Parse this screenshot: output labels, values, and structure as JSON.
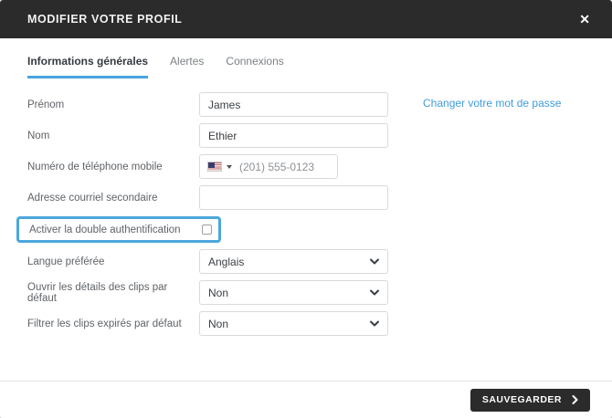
{
  "modal": {
    "title": "MODIFIER VOTRE PROFIL",
    "close_icon": "✕"
  },
  "tabs": [
    {
      "label": "Informations générales",
      "active": true
    },
    {
      "label": "Alertes",
      "active": false
    },
    {
      "label": "Connexions",
      "active": false
    }
  ],
  "form": {
    "first_name": {
      "label": "Prénom",
      "value": "James"
    },
    "last_name": {
      "label": "Nom",
      "value": "Ethier"
    },
    "phone": {
      "label": "Numéro de téléphone mobile",
      "placeholder": "(201) 555-0123",
      "flag": "us-flag",
      "country_caret": "caret-down"
    },
    "secondary_email": {
      "label": "Adresse courriel secondaire",
      "value": "",
      "placeholder": ""
    },
    "two_factor": {
      "label": "Activer la double authentification",
      "checked": false
    },
    "language": {
      "label": "Langue préférée",
      "value": "Anglais"
    },
    "open_clip_details": {
      "label": "Ouvrir les détails des clips par défaut",
      "value": "Non"
    },
    "filter_expired_clips": {
      "label": "Filtrer les clips expirés par défaut",
      "value": "Non"
    }
  },
  "links": {
    "change_password": "Changer votre mot de passe"
  },
  "footer": {
    "save_label": "SAUVEGARDER"
  },
  "colors": {
    "header_dark": "#2b2b2b",
    "accent_blue": "#4aa3df",
    "link_blue": "#3f9cdb",
    "highlight_blue": "#4aa7dc"
  }
}
